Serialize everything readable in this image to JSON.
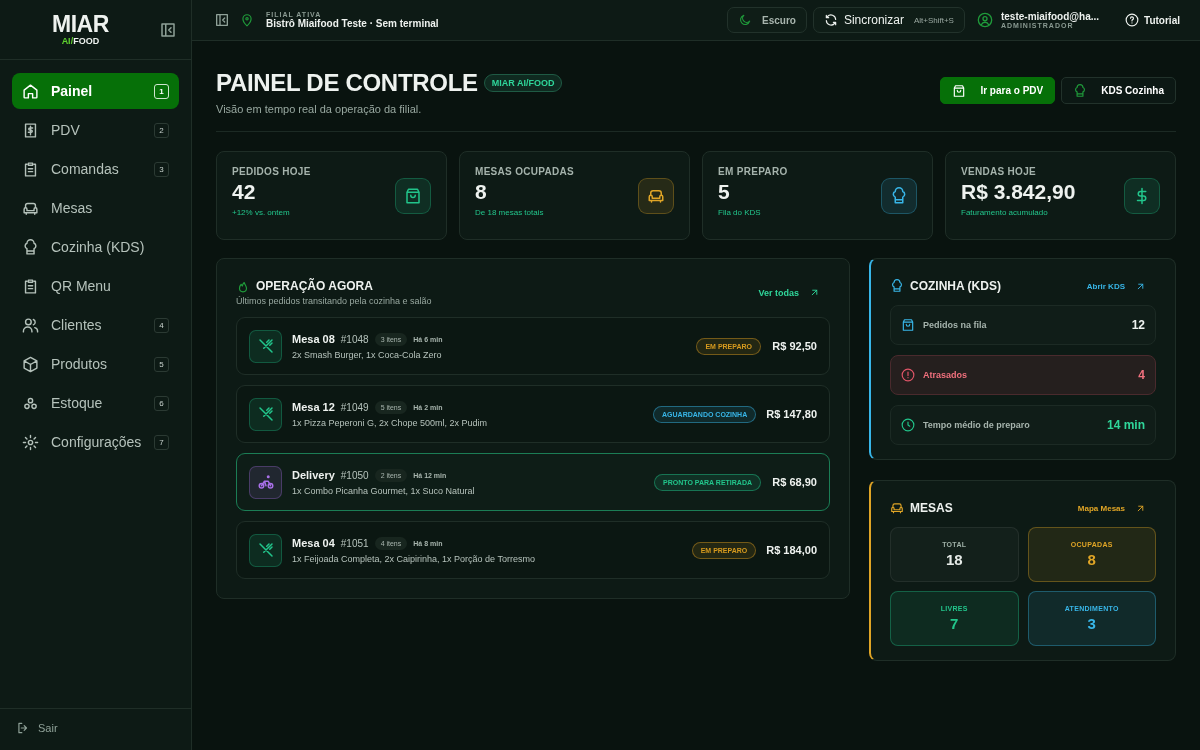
{
  "logo": {
    "title": "MIAR",
    "accent": "AI/",
    "sub": "FOOD"
  },
  "sidebar": {
    "items": [
      {
        "label": "Painel",
        "badge": "1",
        "selected": true
      },
      {
        "label": "PDV",
        "badge": "2",
        "selected": false
      },
      {
        "label": "Comandas",
        "badge": "3",
        "selected": false
      },
      {
        "label": "Mesas",
        "selected": false
      },
      {
        "label": "Cozinha (KDS)",
        "selected": false
      },
      {
        "label": "QR Menu",
        "selected": false
      },
      {
        "label": "Clientes",
        "badge": "4",
        "selected": false
      },
      {
        "label": "Produtos",
        "badge": "5",
        "selected": false
      },
      {
        "label": "Estoque",
        "badge": "6",
        "selected": false
      },
      {
        "label": "Configurações",
        "badge": "7",
        "selected": false
      }
    ],
    "logout": "Sair"
  },
  "header": {
    "branch_label": "FILIAL ATIVA",
    "branch": "Bistrô Miaifood Teste · Sem terminal",
    "theme": "Escuro",
    "sync": "Sincronizar",
    "sync_shortcut": "Alt+Shift+S",
    "user": "teste-miaifood@ha...",
    "role": "ADMINISTRADOR",
    "tutorial": "Tutorial"
  },
  "page": {
    "title": "PAINEL DE CONTROLE",
    "badge": "MIAR AI/FOOD",
    "subtitle": "Visão em tempo real da operação da filial.",
    "primary_button": "Ir para o PDV",
    "secondary_button": "KDS Cozinha"
  },
  "stats": [
    {
      "label": "PEDIDOS HOJE",
      "value": "42",
      "note": "+12% vs. ontem",
      "color": "#22c58b"
    },
    {
      "label": "MESAS OCUPADAS",
      "value": "8",
      "note": "De 18 mesas totais",
      "color": "#e0a526"
    },
    {
      "label": "EM PREPARO",
      "value": "5",
      "note": "Fila do KDS",
      "color": "#38b6e8"
    },
    {
      "label": "VENDAS HOJE",
      "value": "R$ 3.842,90",
      "note": "Faturamento acumulado",
      "color": "#22c58b"
    }
  ],
  "operation": {
    "title": "OPERAÇÃO AGORA",
    "subtitle": "Últimos pedidos transitando pela cozinha e salão",
    "link": "Ver todas",
    "orders": [
      {
        "kind": "mesa",
        "title": "Mesa 08",
        "number": "#1048",
        "items": "3 itens",
        "time": "Há 6 min",
        "desc": "2x Smash Burger, 1x Coca-Cola Zero",
        "status": "EM PREPARO",
        "color": "#d69a1e",
        "price": "R$ 92,50",
        "selected": false
      },
      {
        "kind": "mesa",
        "title": "Mesa 12",
        "number": "#1049",
        "items": "5 itens",
        "time": "Há 2 min",
        "desc": "1x Pizza Peperoni G, 2x Chope 500ml, 2x Pudim",
        "status": "AGUARDANDO COZINHA",
        "color": "#38b6e8",
        "price": "R$ 147,80",
        "selected": false
      },
      {
        "kind": "delivery",
        "title": "Delivery",
        "number": "#1050",
        "items": "2 itens",
        "time": "Há 12 min",
        "desc": "1x Combo Picanha Gourmet, 1x Suco Natural",
        "status": "PRONTO PARA RETIRADA",
        "color": "#22c58b",
        "price": "R$ 68,90",
        "selected": true
      },
      {
        "kind": "mesa",
        "title": "Mesa 04",
        "number": "#1051",
        "items": "4 itens",
        "time": "Há 8 min",
        "desc": "1x Feijoada Completa, 2x Caipirinha, 1x Porção de Torresmo",
        "status": "EM PREPARO",
        "color": "#d69a1e",
        "price": "R$ 184,00",
        "selected": false
      }
    ]
  },
  "kitchen": {
    "title": "COZINHA (KDS)",
    "link": "Abrir KDS",
    "rows": [
      {
        "kind": "queue",
        "label": "Pedidos na fila",
        "value": "12"
      },
      {
        "kind": "alert",
        "label": "Atrasados",
        "value": "4"
      },
      {
        "kind": "time",
        "label": "Tempo médio de preparo",
        "value": "14 min"
      }
    ]
  },
  "tables": {
    "title": "MESAS",
    "link": "Mapa Mesas",
    "tiles": [
      {
        "label": "TOTAL",
        "value": "18",
        "color": "#e6ebe8"
      },
      {
        "label": "OCUPADAS",
        "value": "8",
        "color": "#e0a526"
      },
      {
        "label": "LIVRES",
        "value": "7",
        "color": "#22c58b"
      },
      {
        "label": "ATENDIMENTO",
        "value": "3",
        "color": "#38b6e8"
      }
    ]
  }
}
